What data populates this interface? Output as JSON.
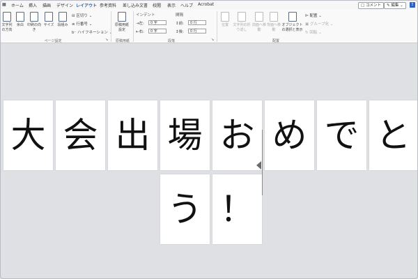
{
  "menu": {
    "tabs": [
      "ホーム",
      "挿入",
      "描画",
      "デザイン",
      "レイアウト",
      "参考資料",
      "差し込み文書",
      "校閲",
      "表示",
      "ヘルプ",
      "Acrobat"
    ],
    "active_tab": "レイアウト",
    "comment_label": "コメント",
    "edit_label": "編集"
  },
  "ribbon": {
    "page_setup": {
      "buttons": [
        "文字列の方向",
        "余白",
        "印刷の向き",
        "サイズ",
        "段組み"
      ],
      "small": [
        "区切り",
        "行番号",
        "ハイフネーション"
      ],
      "group": "ページ設定"
    },
    "manuscript": {
      "button": "原稿用紙設定",
      "group": "原稿用紙"
    },
    "paragraph": {
      "indent_label": "インデント",
      "spacing_label": "間隔",
      "indent_left_label": "左:",
      "indent_left_value": "0 字",
      "indent_right_label": "右:",
      "indent_right_value": "0 字",
      "spacing_before_label": "前:",
      "spacing_before_value": "0 行",
      "spacing_after_label": "後:",
      "spacing_after_value": "0 行",
      "group": "段落"
    },
    "arrange": {
      "buttons": [
        "位置",
        "文字列の折り返し",
        "前面へ移動",
        "背面へ移動",
        "オブジェクトの選択と表示"
      ],
      "small": [
        "配置",
        "グループ化",
        "回転"
      ],
      "group": "配置"
    }
  },
  "document": {
    "row1": [
      "大",
      "会",
      "出",
      "場",
      "お",
      "め",
      "で",
      "と"
    ],
    "row2": [
      "う",
      "！"
    ]
  }
}
